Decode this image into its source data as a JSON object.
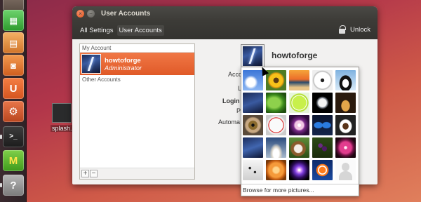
{
  "window": {
    "title": "User Accounts",
    "toolbar": {
      "all_settings": "All Settings",
      "current": "User Accounts",
      "unlock": "Unlock"
    }
  },
  "accounts": {
    "my_account_header": "My Account",
    "current": {
      "name": "howtoforge",
      "role": "Administrator"
    },
    "other_accounts_header": "Other Accounts",
    "add_label": "+",
    "remove_label": "−"
  },
  "details": {
    "username": "howtoforge",
    "fields": [
      "Acco",
      "L",
      "Login",
      "P",
      "Automa"
    ]
  },
  "picker": {
    "browse_label": "Browse for more pictures...",
    "pictures": [
      "clouds",
      "sunflower",
      "sunset-beach",
      "soccer-ball",
      "penguin",
      "lightning",
      "green-leaf",
      "tennis-ball",
      "astronaut",
      "guitar",
      "eye",
      "baseball",
      "snowflake",
      "butterfly",
      "coffee-cup",
      "lightning",
      "shuttle-launch",
      "dog",
      "grapes",
      "pink-flower",
      "dice",
      "orange-rose",
      "plasma-lamp",
      "clownfish",
      "generic-user"
    ]
  },
  "launcher": {
    "items": [
      "files",
      "spreadsheet",
      "presentation",
      "shopping",
      "ubuntu-one",
      "system-settings",
      "terminal",
      "app-m",
      "help"
    ]
  },
  "desktop": {
    "icon_label": "splash."
  }
}
